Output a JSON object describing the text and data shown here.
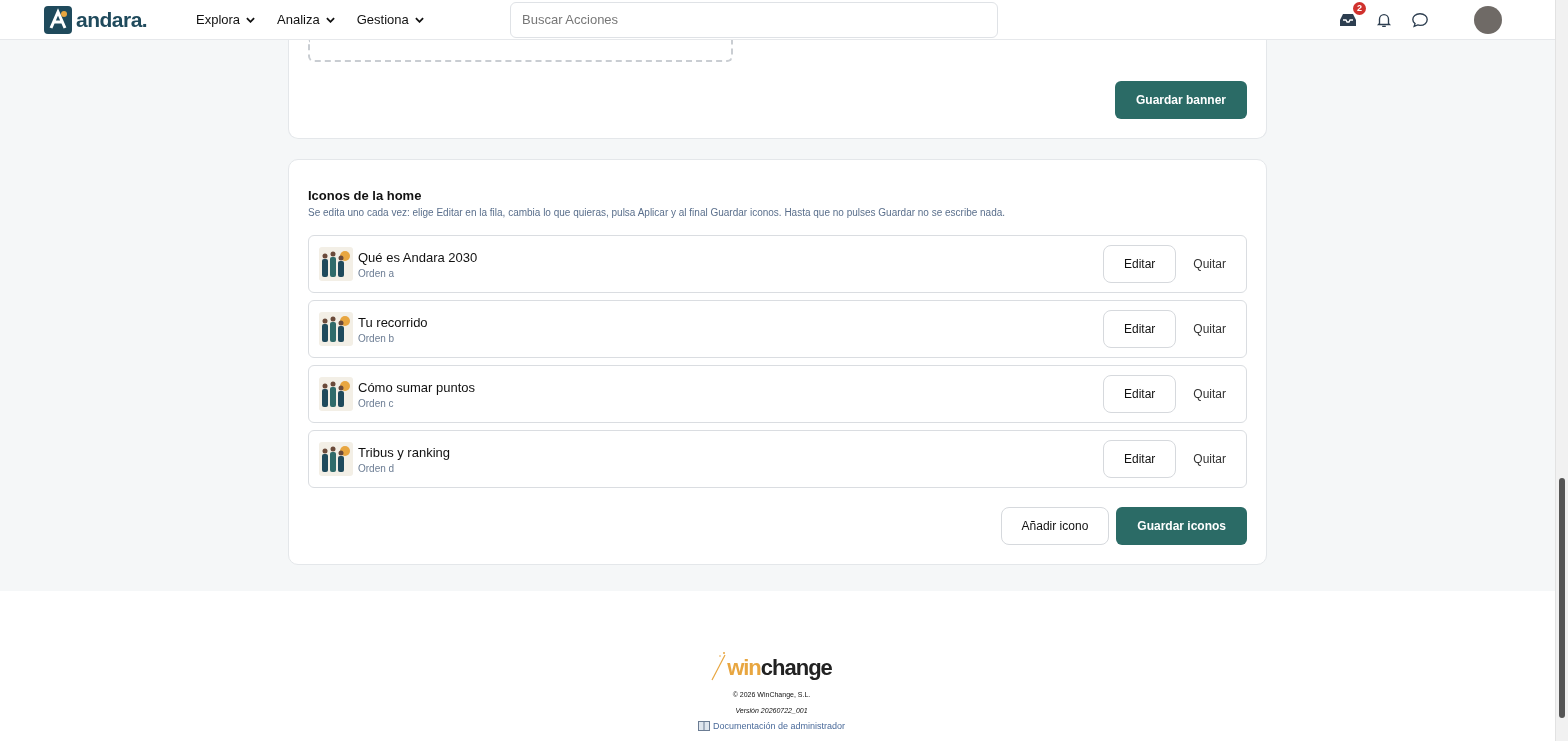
{
  "header": {
    "logo_text": "andara.",
    "nav": [
      {
        "label": "Explora"
      },
      {
        "label": "Analiza"
      },
      {
        "label": "Gestiona"
      }
    ],
    "search": {
      "placeholder": "Buscar Acciones"
    },
    "inbox_badge": "2"
  },
  "banner_card": {
    "save_button": "Guardar banner"
  },
  "icons_card": {
    "title": "Iconos de la home",
    "description": "Se edita uno cada vez: elige Editar en la fila, cambia lo que quieras, pulsa Aplicar y al final Guardar iconos. Hasta que no pulses Guardar no se escribe nada.",
    "rows": [
      {
        "title": "Qué es Andara 2030",
        "order": "Orden a",
        "edit": "Editar",
        "remove": "Quitar"
      },
      {
        "title": "Tu recorrido",
        "order": "Orden b",
        "edit": "Editar",
        "remove": "Quitar"
      },
      {
        "title": "Cómo sumar puntos",
        "order": "Orden c",
        "edit": "Editar",
        "remove": "Quitar"
      },
      {
        "title": "Tribus y ranking",
        "order": "Orden d",
        "edit": "Editar",
        "remove": "Quitar"
      }
    ],
    "add_button": "Añadir icono",
    "save_button": "Guardar iconos"
  },
  "footer": {
    "logo_parts": [
      "win",
      "change"
    ],
    "copyright": "© 2026 WinChange, S.L.",
    "version": "Versión 20260722_001",
    "docs_link": "Documentación de administrador"
  }
}
